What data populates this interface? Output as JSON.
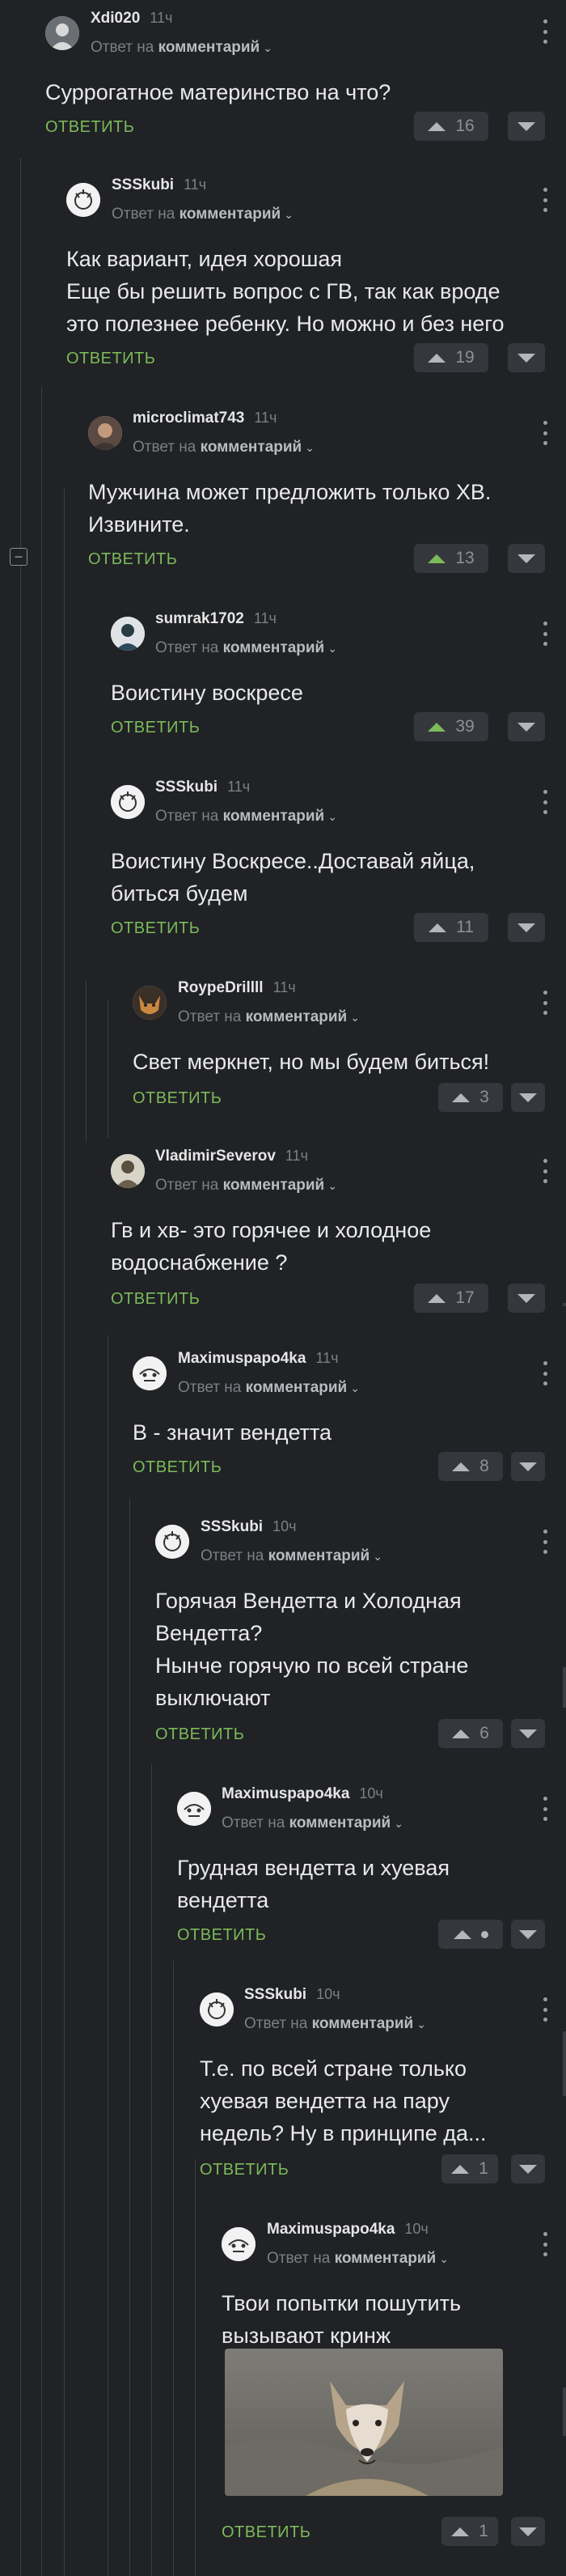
{
  "common": {
    "reply_prefix": "Ответ на",
    "reply_link": "комментарий",
    "answer_label": "ОТВЕТИТЬ",
    "collapse_symbol": "−"
  },
  "comments": [
    {
      "author": "Xdi020",
      "time": "11ч",
      "text": "Суррогатное материнство на что?",
      "votes": "16",
      "vote_active": false
    },
    {
      "author": "SSSkubi",
      "time": "11ч",
      "text": "Как вариант, идея хорошая\nЕще бы решить вопрос с ГВ, так как вроде\nэто полезнее ребенку. Но можно и без него",
      "votes": "19",
      "vote_active": false
    },
    {
      "author": "microclimat743",
      "time": "11ч",
      "text": "Мужчина может предложить только ХВ.\nИзвините.",
      "votes": "13",
      "vote_active": true
    },
    {
      "author": "sumrak1702",
      "time": "11ч",
      "text": "Воистину воскресе",
      "votes": "39",
      "vote_active": true
    },
    {
      "author": "SSSkubi",
      "time": "11ч",
      "text": "Воистину Воскресе..Доставай яйца,\nбиться будем",
      "votes": "11",
      "vote_active": false
    },
    {
      "author": "RoypeDrillll",
      "time": "11ч",
      "text": "Свет меркнет, но мы будем биться!",
      "votes": "3",
      "vote_active": false
    },
    {
      "author": "VladimirSeverov",
      "time": "11ч",
      "text": "Гв и хв- это горячее и холодное\nводоснабжение ?",
      "votes": "17",
      "vote_active": false
    },
    {
      "author": "Maximuspapo4ka",
      "time": "11ч",
      "text": "В - значит вендетта",
      "votes": "8",
      "vote_active": false
    },
    {
      "author": "SSSkubi",
      "time": "10ч",
      "text": "Горячая Вендетта и Холодная\nВендетта?\nНынче горячую по всей стране\nвыключают",
      "votes": "6",
      "vote_active": false
    },
    {
      "author": "Maximuspapo4ka",
      "time": "10ч",
      "text": "Грудная вендетта и хуевая\nвендетта",
      "votes": "",
      "vote_active": false
    },
    {
      "author": "SSSkubi",
      "time": "10ч",
      "text": "Т.е. по всей стране только\nхуевая вендетта на пару\nнедель? Ну в принципе да...",
      "votes": "1",
      "vote_active": false
    },
    {
      "author": "Maximuspapo4ka",
      "time": "10ч",
      "text": "Твои попытки пошутить\nвызывают кринж",
      "votes": "1",
      "vote_active": false
    }
  ]
}
